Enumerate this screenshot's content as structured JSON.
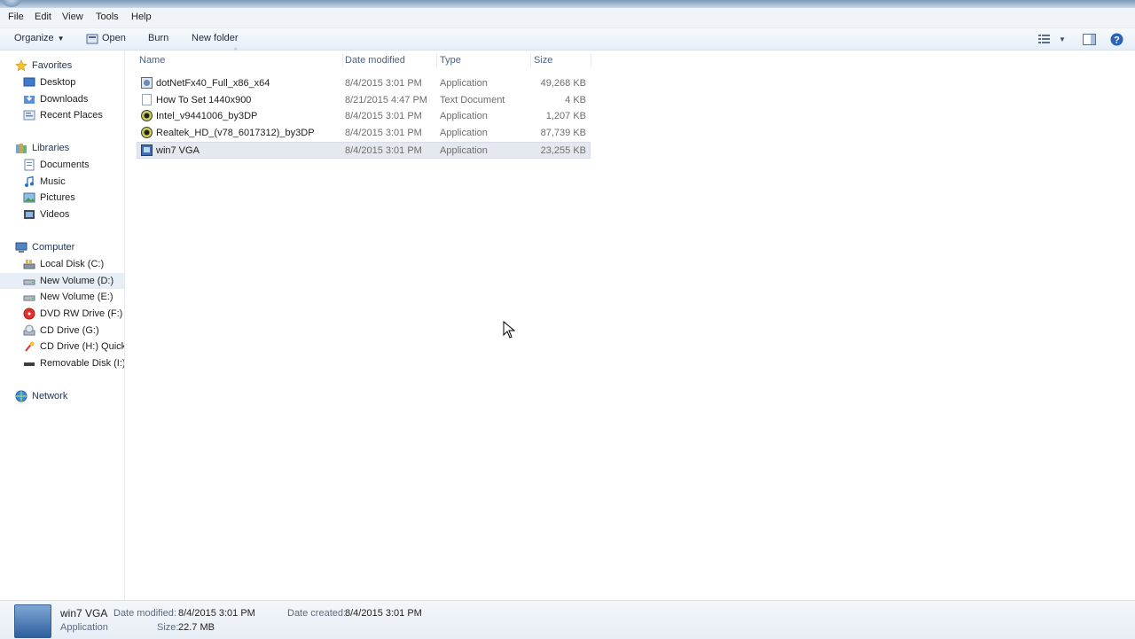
{
  "menu": [
    "File",
    "Edit",
    "View",
    "Tools",
    "Help"
  ],
  "toolbar": {
    "organize": "Organize",
    "open": "Open",
    "burn": "Burn",
    "new_folder": "New folder"
  },
  "nav": {
    "favorites": {
      "label": "Favorites",
      "items": [
        "Desktop",
        "Downloads",
        "Recent Places"
      ]
    },
    "libraries": {
      "label": "Libraries",
      "items": [
        "Documents",
        "Music",
        "Pictures",
        "Videos"
      ]
    },
    "computer": {
      "label": "Computer",
      "items": [
        "Local Disk (C:)",
        "New Volume (D:)",
        "New Volume (E:)",
        "DVD RW Drive (F:) Re",
        "CD Drive (G:)",
        "CD Drive (H:) Quick",
        "Removable Disk (I:)"
      ]
    },
    "network": {
      "label": "Network"
    }
  },
  "columns": {
    "name": "Name",
    "date": "Date modified",
    "type": "Type",
    "size": "Size"
  },
  "files": [
    {
      "name": "dotNetFx40_Full_x86_x64",
      "date": "8/4/2015 3:01 PM",
      "type": "Application",
      "size": "49,268 KB",
      "icon": "installer-icon"
    },
    {
      "name": "How To Set 1440x900",
      "date": "8/21/2015 4:47 PM",
      "type": "Text Document",
      "size": "4 KB",
      "icon": "text-document-icon"
    },
    {
      "name": "Intel_v9441006_by3DP",
      "date": "8/4/2015 3:01 PM",
      "type": "Application",
      "size": "1,207 KB",
      "icon": "3dp-app-icon"
    },
    {
      "name": "Realtek_HD_(v78_6017312)_by3DP",
      "date": "8/4/2015 3:01 PM",
      "type": "Application",
      "size": "87,739 KB",
      "icon": "3dp-app-icon"
    },
    {
      "name": "win7 VGA",
      "date": "8/4/2015 3:01 PM",
      "type": "Application",
      "size": "23,255 KB",
      "icon": "vga-app-icon"
    }
  ],
  "details": {
    "name": "win7 VGA",
    "type": "Application",
    "date_modified_label": "Date modified:",
    "date_modified": "8/4/2015 3:01 PM",
    "date_created_label": "Date created:",
    "date_created": "8/4/2015 3:01 PM",
    "size_label": "Size:",
    "size": "22.7 MB"
  },
  "colors": {
    "selection": "#e5e9ef",
    "nav_selection": "#e8eef6",
    "header_text": "#4d6185"
  }
}
